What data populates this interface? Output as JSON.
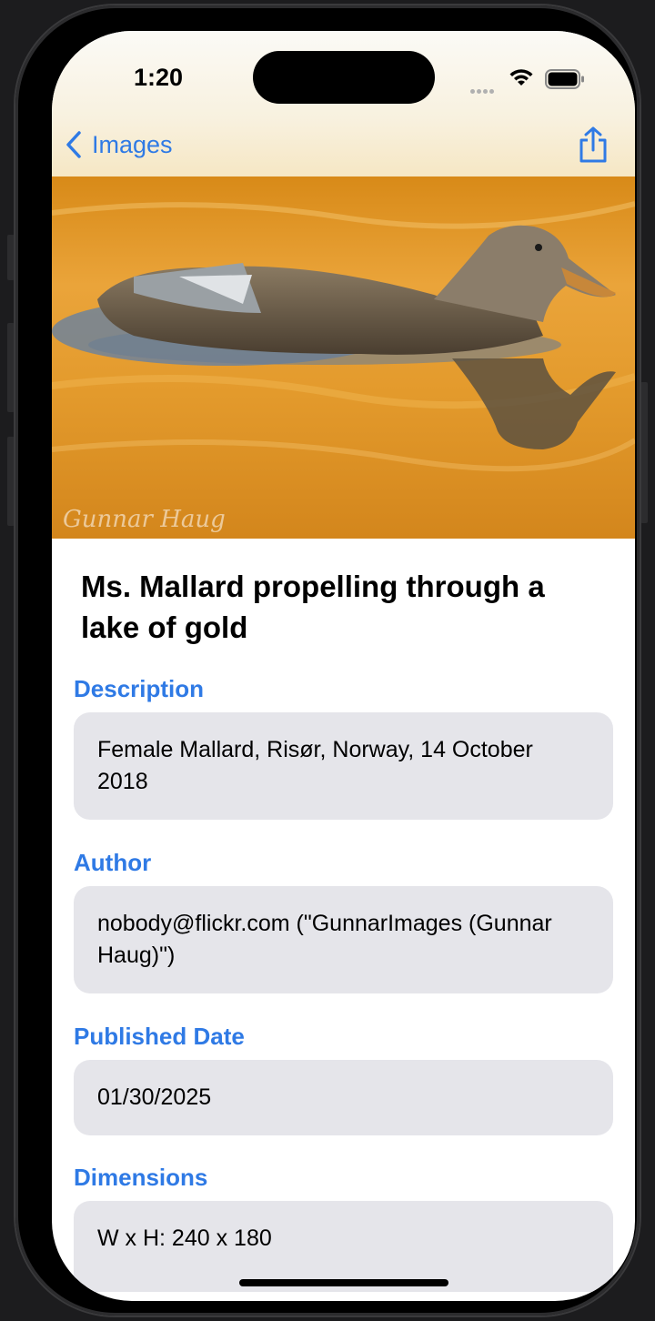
{
  "status_bar": {
    "time": "1:20"
  },
  "nav": {
    "back_label": "Images"
  },
  "photo": {
    "watermark": "Gunnar Haug"
  },
  "detail": {
    "title": "Ms. Mallard propelling through a lake of gold",
    "sections": [
      {
        "label": "Description",
        "value": "Female Mallard, Risør, Norway, 14 October 2018"
      },
      {
        "label": "Author",
        "value": "nobody@flickr.com (\"GunnarImages (Gunnar Haug)\")"
      },
      {
        "label": "Published Date",
        "value": "01/30/2025"
      },
      {
        "label": "Dimensions",
        "value": "W x H: 240 x 180"
      }
    ]
  },
  "colors": {
    "accent": "#2f7ae5",
    "card": "#e5e5ea"
  },
  "icons": [
    "chevron-left-icon",
    "share-icon",
    "wifi-icon",
    "battery-icon",
    "cellular-icon"
  ]
}
